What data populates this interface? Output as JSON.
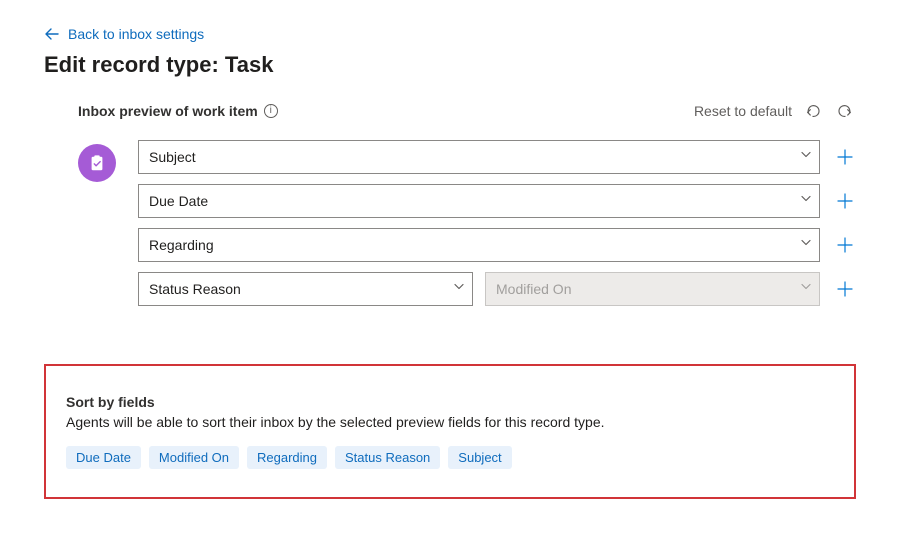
{
  "back_link": "Back to inbox settings",
  "page_title": "Edit record type: Task",
  "preview": {
    "title": "Inbox preview of work item",
    "reset_label": "Reset to default",
    "rows": [
      {
        "fields": [
          {
            "label": "Subject",
            "disabled": false
          }
        ]
      },
      {
        "fields": [
          {
            "label": "Due Date",
            "disabled": false
          }
        ]
      },
      {
        "fields": [
          {
            "label": "Regarding",
            "disabled": false
          }
        ]
      },
      {
        "fields": [
          {
            "label": "Status Reason",
            "disabled": false
          },
          {
            "label": "Modified On",
            "disabled": true
          }
        ]
      }
    ]
  },
  "sort": {
    "title": "Sort by fields",
    "description": "Agents will be able to sort their inbox by the selected preview fields for this record type.",
    "chips": [
      "Due Date",
      "Modified On",
      "Regarding",
      "Status Reason",
      "Subject"
    ]
  },
  "icons": {
    "task": "task-clipboard-icon",
    "info": "info-icon",
    "undo": "undo-icon",
    "redo": "redo-icon",
    "plus": "plus-icon",
    "chevron": "chevron-down-icon",
    "back": "arrow-left-icon"
  }
}
